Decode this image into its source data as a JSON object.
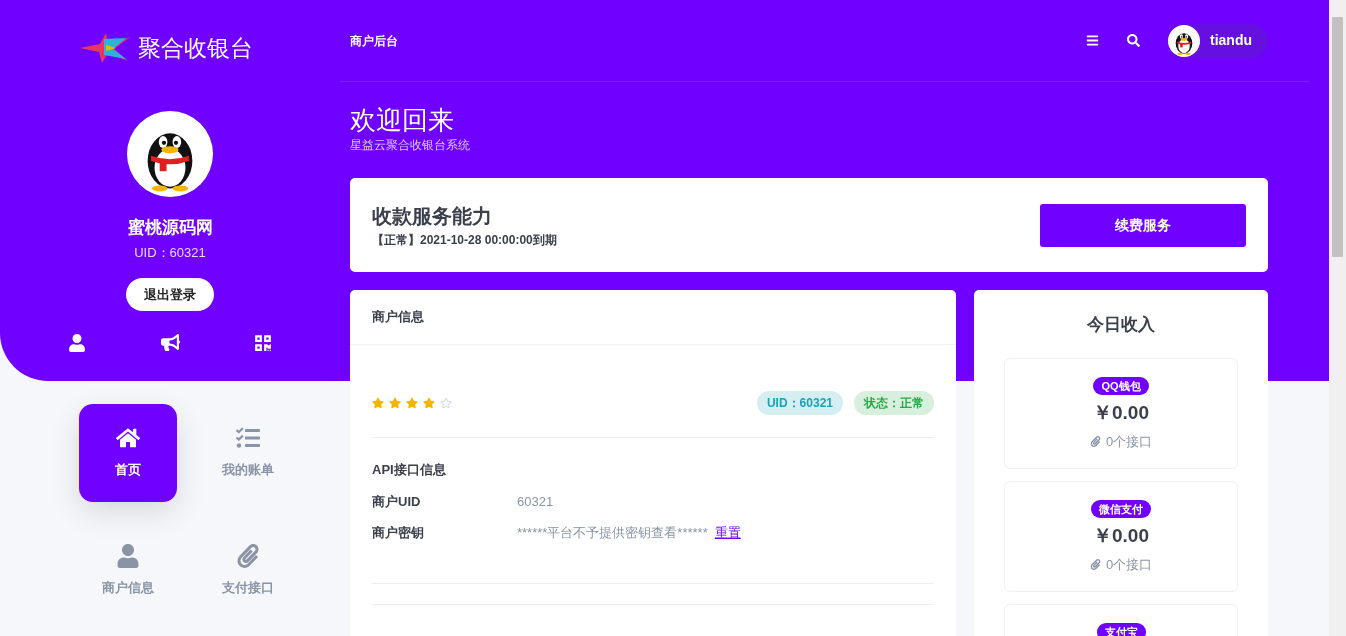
{
  "brand": {
    "name": "聚合收银台"
  },
  "topbar": {
    "title": "商户后台",
    "user": "tiandu"
  },
  "profile": {
    "name": "蜜桃源码网",
    "uid": "UID：60321",
    "logout": "退出登录"
  },
  "nav": [
    {
      "label": "首页",
      "selected": true
    },
    {
      "label": "我的账单",
      "selected": false
    },
    {
      "label": "商户信息",
      "selected": false
    },
    {
      "label": "支付接口",
      "selected": false
    }
  ],
  "welcome": {
    "title": "欢迎回来",
    "subtitle": "星益云聚合收银台系统"
  },
  "service": {
    "title": "收款服务能力",
    "status": "【正常】2021-10-28 00:00:00到期",
    "button": "续费服务"
  },
  "merchant": {
    "tab": "商户信息",
    "stars": 4,
    "badges": [
      {
        "text": "UID：60321",
        "color": "#17a2b8"
      },
      {
        "text": "状态：正常",
        "color": "#28a745"
      }
    ],
    "api_title": "API接口信息",
    "rows": [
      {
        "label": "商户UID",
        "value": "60321"
      },
      {
        "label": "商户密钥",
        "value": "******平台不予提供密钥查看******",
        "link": "重置"
      }
    ]
  },
  "income": {
    "title": "今日收入",
    "items": [
      {
        "badge": "QQ钱包",
        "amount": "￥0.00",
        "interfaces": "0个接口"
      },
      {
        "badge": "微信支付",
        "amount": "￥0.00",
        "interfaces": "0个接口"
      },
      {
        "badge": "支付宝"
      }
    ]
  }
}
